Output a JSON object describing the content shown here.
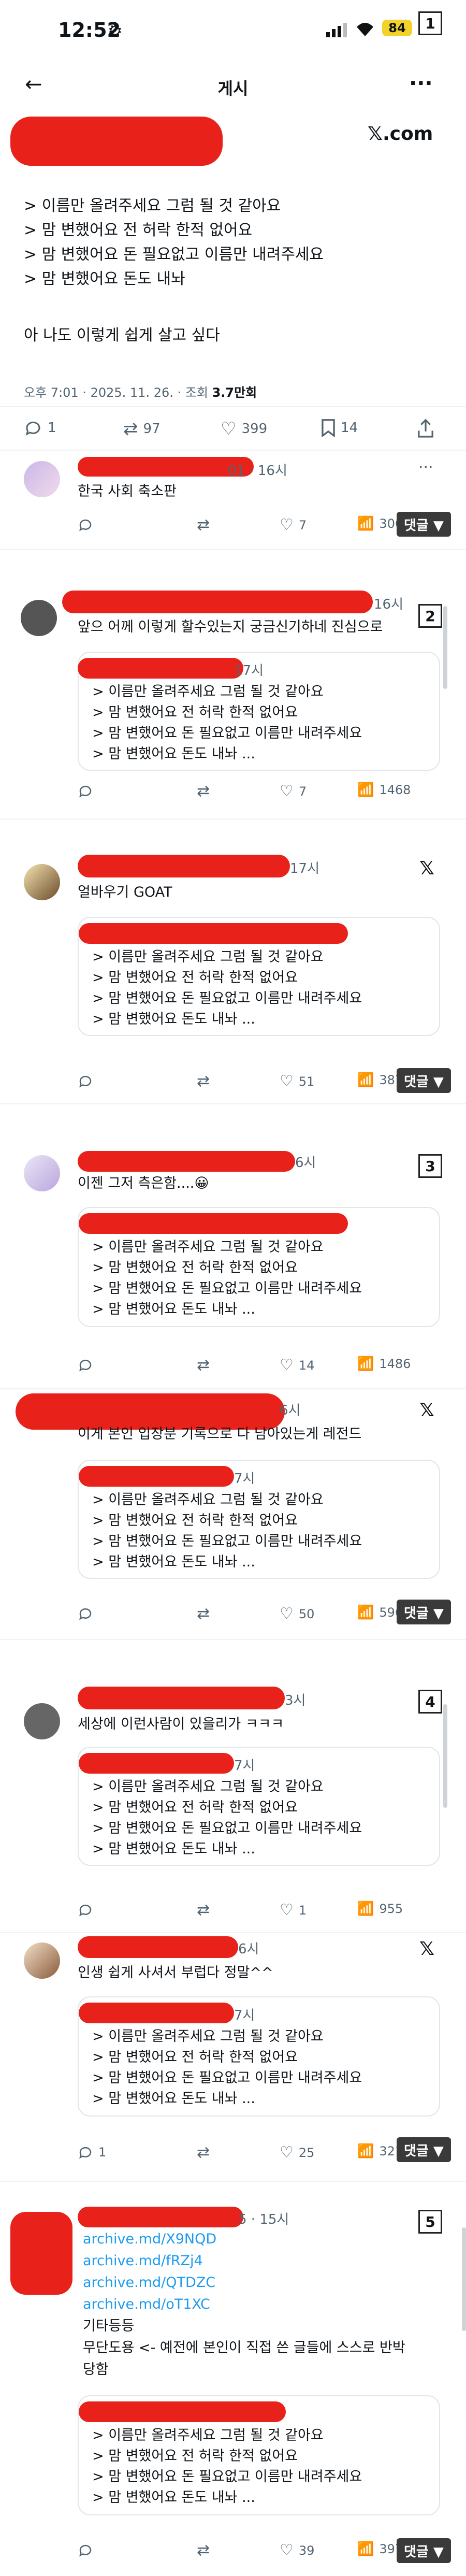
{
  "status": {
    "time": "12:52",
    "battery": "84",
    "page_num": "1"
  },
  "header": {
    "title": "게시",
    "back_icon": "arrow-left-icon",
    "more_icon": "more-icon",
    "brand": "𝕏.com"
  },
  "post": {
    "lines": [
      "> 이름만 올려주세요 그럼 될 것 같아요",
      "> 맘 변했어요 전 허락 한적 없어요",
      "> 맘 변했어요 돈 필요없고 이름만 내려주세요",
      "> 맘 변했어요 돈도 내놔",
      "아 나도 이렇게 쉽게 살고 싶다"
    ],
    "meta_time": "오후 7:01 · 2025. 11. 26. · 조회",
    "meta_views": "3.7만회",
    "replies": "1",
    "retweets": "97",
    "likes": "399",
    "bookmarks": "14"
  },
  "quote_lines": [
    "> 이름만 올려주세요 그럼 될 것 같아요",
    "> 맘 변했어요 전 허락 한적 없어요",
    "> 맘 변했어요 돈 필요없고 이름만 내려주세요",
    "> 맘 변했어요 돈도 내놔 ..."
  ],
  "replies": [
    {
      "time": "01 · 16시",
      "text": "한국 사회 축소판",
      "likes": "7",
      "views": "3067",
      "btn": "댓글 ▼"
    },
    {
      "time": "16시",
      "text": "앞으 어께 이렇게 할수있는지 궁금신기하네 진심으로",
      "qtime": "17시",
      "likes": "7",
      "views": "1468"
    },
    {
      "time": "17시",
      "text": "얼바우기 GOAT",
      "likes": "51",
      "views": "3878",
      "btn": "댓글 ▼"
    },
    {
      "time": "6시",
      "text": "이젠 그저 측은함....😀",
      "likes": "14",
      "views": "1486",
      "page": "3"
    },
    {
      "time": "6시",
      "text": "이게 본인 입장분 기록으로 다 남아있는게 레전드",
      "qtime": "7시",
      "likes": "50",
      "views": "5966",
      "btn": "댓글 ▼"
    },
    {
      "time": "3시",
      "text": "세상에 이런사람이 있을리가 ㅋㅋㅋ",
      "qtime": "7시",
      "likes": "1",
      "views": "955",
      "page": "4"
    },
    {
      "time": "6시",
      "text": "인생 쉽게 사셔서 부럽다 정말^^",
      "qtime": "7시",
      "likes": "25",
      "views": "3217",
      "btn": "댓글 ▼"
    },
    {
      "time": "5 · 15시",
      "links": [
        "archive.md/X9NQD",
        "archive.md/fRZj4",
        "archive.md/QTDZC",
        "archive.md/oT1XC"
      ],
      "text1": "기타등등",
      "text2": "무단도용 <- 예전에 본인이 직접 쓴 글들에 스스로 반박",
      "text3": "당함",
      "likes": "39",
      "views": "3979",
      "btn": "댓글 ▼",
      "page": "5"
    }
  ],
  "page2": "2"
}
